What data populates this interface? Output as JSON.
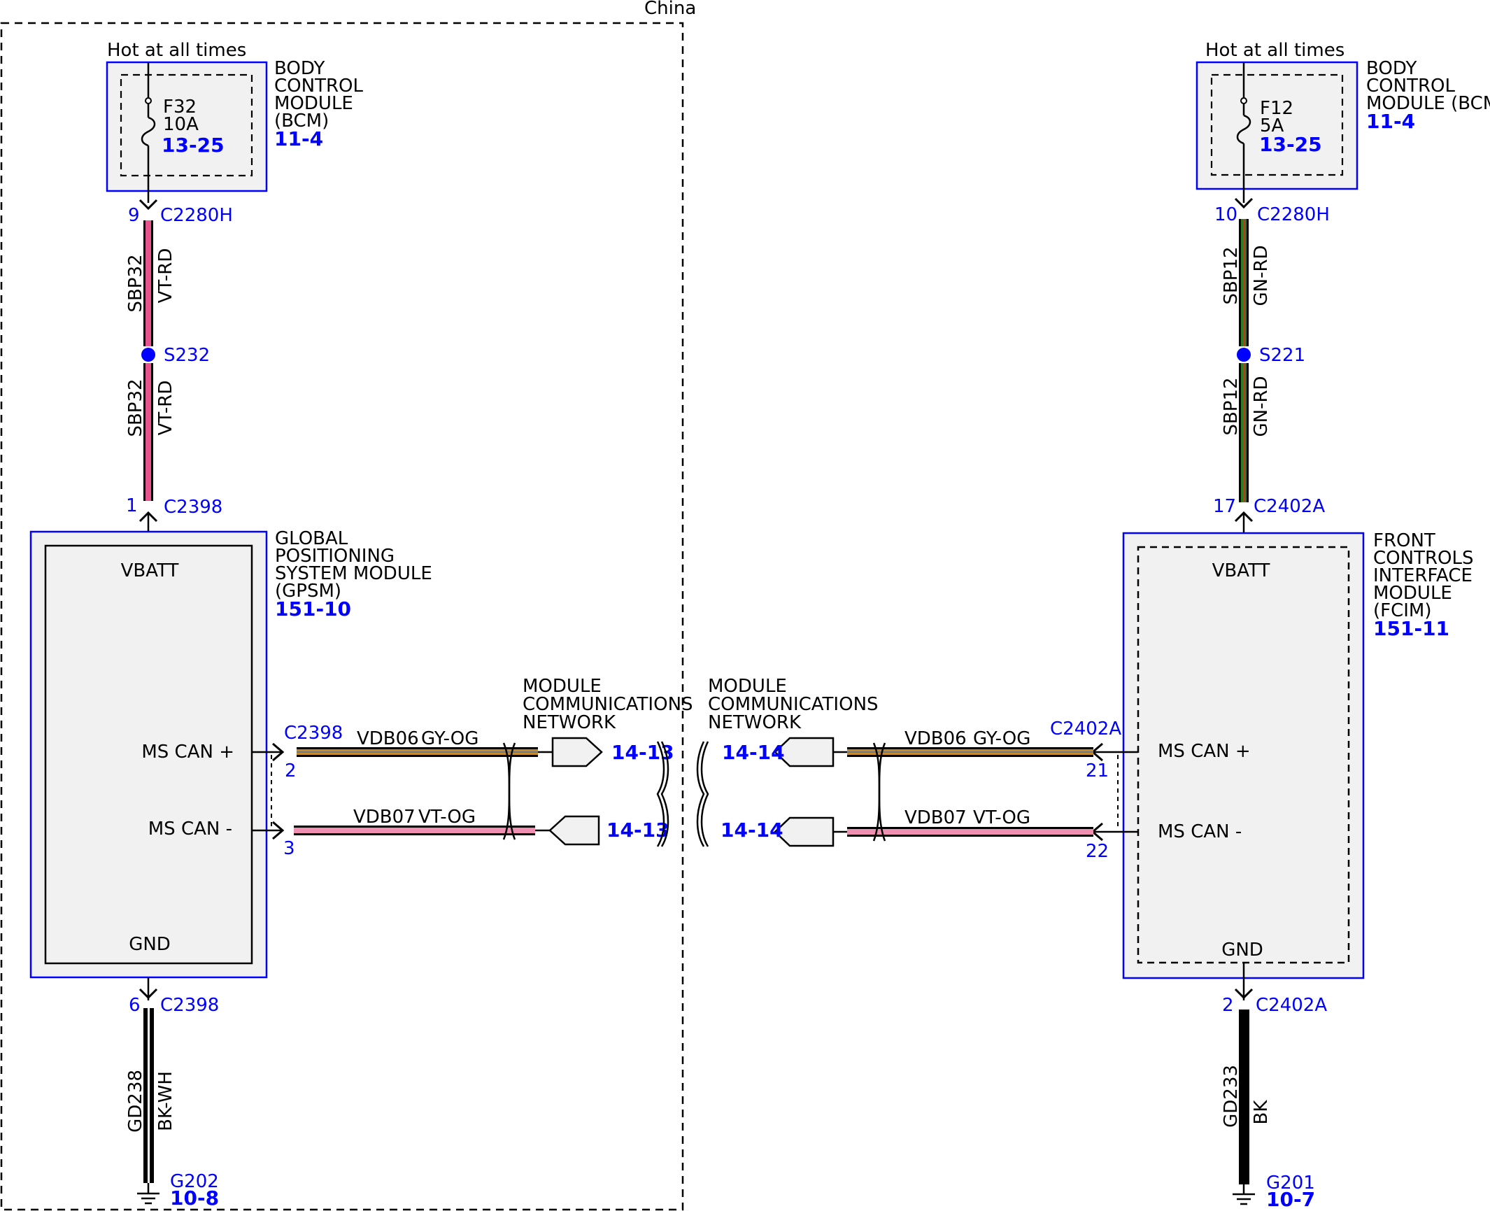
{
  "region_label": "China",
  "colors": {
    "link_blue": "#0000ff",
    "wire_vt_rd": "#e8538f",
    "wire_gn_rd": "#2f7d1f",
    "wire_gy_og": "#c58a2e",
    "wire_vt_og": "#ef8fb1",
    "wire_bk": "#000000",
    "box_fill": "#f1f1f1"
  },
  "left": {
    "hot_label": "Hot at all times",
    "bcm": {
      "name_lines": [
        "BODY",
        "CONTROL",
        "MODULE",
        "(BCM)"
      ],
      "ref": "11-4",
      "fuse": {
        "id": "F32",
        "rating": "10A",
        "ref": "13-25"
      }
    },
    "connector_top": {
      "pin": "9",
      "id": "C2280H"
    },
    "wire_upper": {
      "circuit": "SBP32",
      "color": "VT-RD"
    },
    "splice": "S232",
    "wire_lower": {
      "circuit": "SBP32",
      "color": "VT-RD"
    },
    "connector_module": {
      "pin": "1",
      "id": "C2398"
    },
    "module": {
      "name_lines": [
        "GLOBAL",
        "POSITIONING",
        "SYSTEM MODULE",
        "(GPSM)"
      ],
      "ref": "151-10",
      "vbatt": "VBATT",
      "can_plus": "MS CAN +",
      "can_minus": "MS CAN -",
      "gnd": "GND"
    },
    "can_connector": "C2398",
    "can_plus_pin": "2",
    "can_minus_pin": "3",
    "can_wire_plus": {
      "circuit": "VDB06",
      "color": "GY-OG"
    },
    "can_wire_minus": {
      "circuit": "VDB07",
      "color": "VT-OG"
    },
    "network_lines": [
      "MODULE",
      "COMMUNICATIONS",
      "NETWORK"
    ],
    "network_ref_plus": "14-13",
    "network_ref_minus": "14-13",
    "connector_gnd": {
      "pin": "6",
      "id": "C2398"
    },
    "wire_gnd": {
      "circuit": "GD238",
      "color": "BK-WH"
    },
    "ground": {
      "id": "G202",
      "ref": "10-8"
    }
  },
  "right": {
    "hot_label": "Hot at all times",
    "bcm": {
      "name_lines": [
        "BODY",
        "CONTROL",
        "MODULE (BCM)"
      ],
      "ref": "11-4",
      "fuse": {
        "id": "F12",
        "rating": "5A",
        "ref": "13-25"
      }
    },
    "connector_top": {
      "pin": "10",
      "id": "C2280H"
    },
    "wire_upper": {
      "circuit": "SBP12",
      "color": "GN-RD"
    },
    "splice": "S221",
    "wire_lower": {
      "circuit": "SBP12",
      "color": "GN-RD"
    },
    "connector_module": {
      "pin": "17",
      "id": "C2402A"
    },
    "module": {
      "name_lines": [
        "FRONT",
        "CONTROLS",
        "INTERFACE",
        "MODULE",
        "(FCIM)"
      ],
      "ref": "151-11",
      "vbatt": "VBATT",
      "can_plus": "MS CAN +",
      "can_minus": "MS CAN -",
      "gnd": "GND"
    },
    "can_connector": "C2402A",
    "can_plus_pin": "21",
    "can_minus_pin": "22",
    "can_wire_plus": {
      "circuit": "VDB06",
      "color": "GY-OG"
    },
    "can_wire_minus": {
      "circuit": "VDB07",
      "color": "VT-OG"
    },
    "network_lines": [
      "MODULE",
      "COMMUNICATIONS",
      "NETWORK"
    ],
    "network_ref_plus": "14-14",
    "network_ref_minus": "14-14",
    "connector_gnd": {
      "pin": "2",
      "id": "C2402A"
    },
    "wire_gnd": {
      "circuit": "GD233",
      "color": "BK"
    },
    "ground": {
      "id": "G201",
      "ref": "10-7"
    }
  }
}
